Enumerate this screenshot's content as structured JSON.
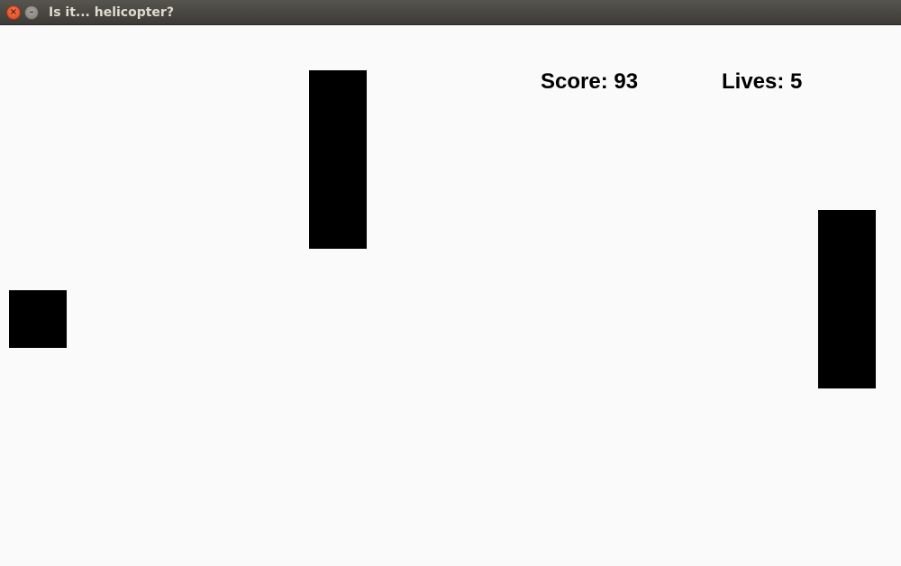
{
  "window": {
    "title": "Is it... helicopter?",
    "close_glyph": "×",
    "minimize_glyph": "–"
  },
  "hud": {
    "score_label": "Score:",
    "score_value": 93,
    "lives_label": "Lives:",
    "lives_value": 5
  },
  "colors": {
    "background": "#fafafa",
    "block": "#000000",
    "text": "#000000"
  }
}
